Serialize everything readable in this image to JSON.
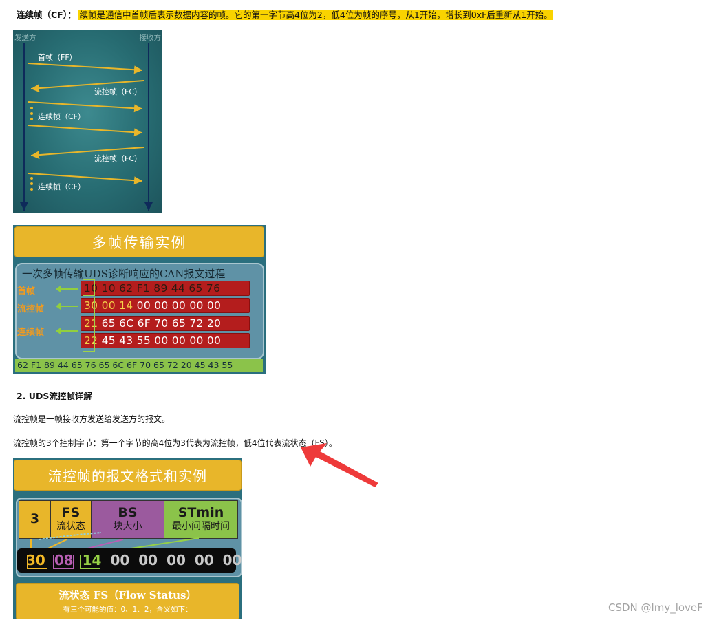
{
  "cf_line": {
    "label": "连续帧（CF）：",
    "text": "续帧是通信中首帧后表示数据内容的帧。它的第一字节高4位为2，低4位为帧的序号，从1开始，增长到0xF后重新从1开始。"
  },
  "fig1": {
    "sender": "发送方",
    "receiver": "接收方",
    "labels": [
      "首帧（FF）",
      "流控帧（FC）",
      "连续帧（CF）",
      "流控帧（FC）",
      "连续帧（CF）"
    ]
  },
  "fig2": {
    "title": "多帧传输实例",
    "subtitle": "一次多帧传输UDS诊断响应的CAN报文过程",
    "row_labels": [
      "首帧",
      "流控帧",
      "连续帧"
    ],
    "frames": [
      {
        "pci": "10",
        "mid": "10",
        "rest": "62 F1 89 44 65 76"
      },
      {
        "pci": "30",
        "mid": "00 14",
        "rest": "00 00 00 00 00"
      },
      {
        "pci": "21",
        "mid": "",
        "rest": "65 6C 6F 70 65 72 20"
      },
      {
        "pci": "22",
        "mid": "",
        "rest": "45 43 55 00 00 00 00"
      }
    ],
    "footer": "62 F1 89 44 65 76 65 6C 6F 70 65 72 20 45 43 55"
  },
  "section_heading": "2. UDS流控帧详解",
  "para1": "流控帧是一帧接收方发送给发送方的报文。",
  "para2": "流控帧的3个控制字节：第一个字节的高4位为3代表为流控帧，低4位代表流状态（FS）。",
  "fig3": {
    "title": "流控帧的报文格式和实例",
    "cells": [
      {
        "big": "3",
        "small": "",
        "color": "#e8b62a"
      },
      {
        "big": "FS",
        "small": "流状态",
        "color": "#e8b62a"
      },
      {
        "big": "BS",
        "small": "块大小",
        "color": "#9b5a9e"
      },
      {
        "big": "STmin",
        "small": "最小间隔时间",
        "color": "#8bc34a"
      }
    ],
    "bytes": {
      "b1": "30",
      "b2": "08",
      "b3": "14",
      "rest": "00 00 00 00 00"
    },
    "bottom_title": "流状态  FS（Flow Status）",
    "bottom_sub": "有三个可能的值：0、1、2，含义如下："
  },
  "watermark": "CSDN @lmy_loveF",
  "colors": {
    "highlight": "#f9d300",
    "arrow_red": "#ee3a3a"
  }
}
